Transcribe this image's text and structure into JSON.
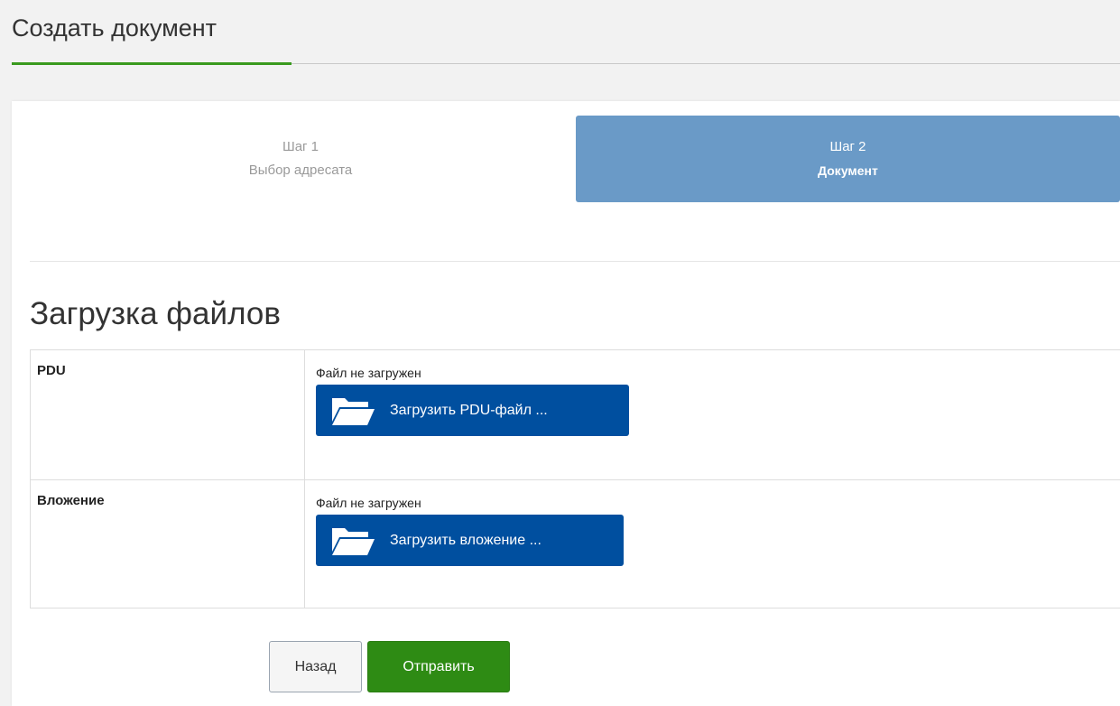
{
  "header": {
    "title": "Создать документ"
  },
  "steps": [
    {
      "number": "Шаг 1",
      "name": "Выбор адресата",
      "active": false
    },
    {
      "number": "Шаг 2",
      "name": "Документ",
      "active": true
    }
  ],
  "section": {
    "title": "Загрузка файлов"
  },
  "files": [
    {
      "label": "PDU",
      "status": "Файл не загружен",
      "button_label": "Загрузить PDU-файл ...",
      "icon": "folder-icon"
    },
    {
      "label": "Вложение",
      "status": "Файл не загружен",
      "button_label": "Загрузить вложение ...",
      "icon": "folder-icon"
    }
  ],
  "actions": {
    "back_label": "Назад",
    "submit_label": "Отправить"
  },
  "colors": {
    "accent_green": "#3a9a1e",
    "active_step": "#6a9ac7",
    "upload_button": "#004f9f",
    "submit_button": "#2e8b14"
  }
}
